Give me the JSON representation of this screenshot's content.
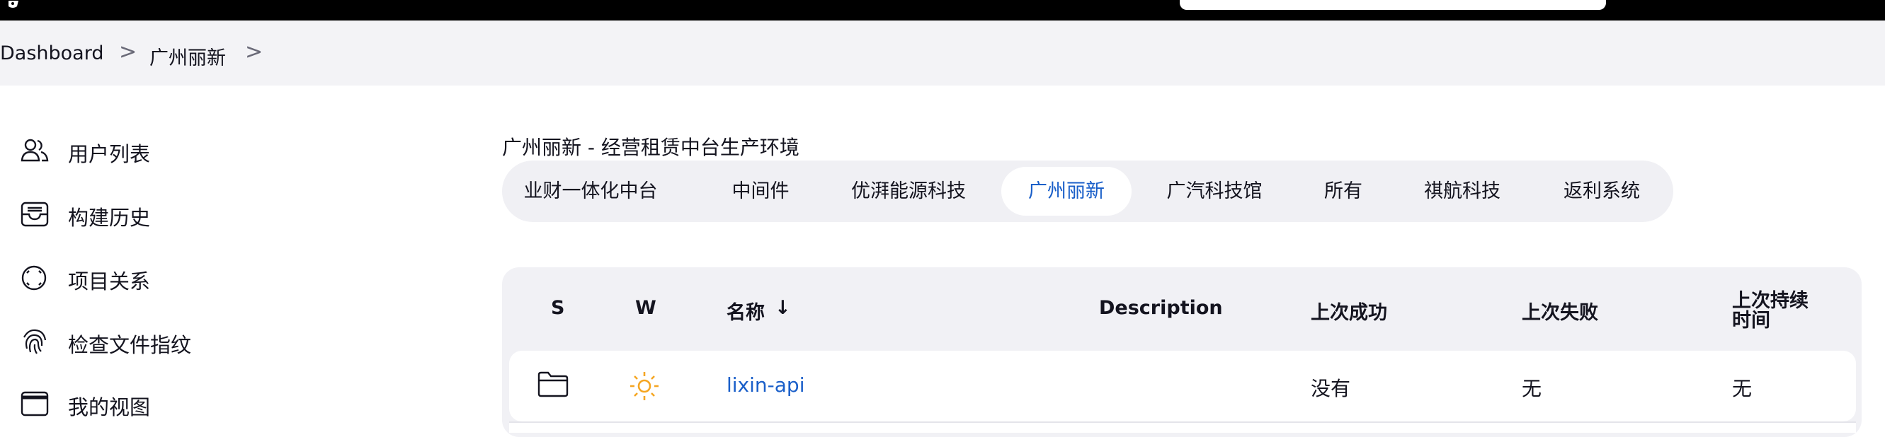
{
  "breadcrumb": {
    "items": [
      "Dashboard",
      "广州丽新"
    ],
    "separator": ">"
  },
  "sidebar": {
    "items": [
      {
        "label": "用户列表",
        "icon": "people-icon"
      },
      {
        "label": "构建历史",
        "icon": "inbox-icon"
      },
      {
        "label": "项目关系",
        "icon": "relationship-icon"
      },
      {
        "label": "检查文件指纹",
        "icon": "fingerprint-icon"
      },
      {
        "label": "我的视图",
        "icon": "window-icon"
      }
    ]
  },
  "view": {
    "description": "广州丽新 - 经营租赁中台生产环境"
  },
  "tabs": [
    {
      "label": "业财一体化中台",
      "active": false
    },
    {
      "label": "中间件",
      "active": false
    },
    {
      "label": "优湃能源科技",
      "active": false
    },
    {
      "label": "广州丽新",
      "active": true
    },
    {
      "label": "广汽科技馆",
      "active": false
    },
    {
      "label": "所有",
      "active": false
    },
    {
      "label": "祺航科技",
      "active": false
    },
    {
      "label": "返利系统",
      "active": false
    }
  ],
  "table": {
    "headers": {
      "s": "S",
      "w": "W",
      "name": "名称",
      "sort_indicator": "↓",
      "description": "Description",
      "last_success": "上次成功",
      "last_failure": "上次失败",
      "last_duration": "上次持续时间"
    },
    "rows": [
      {
        "status_icon": "folder-icon",
        "weather_icon": "sun-icon",
        "name": "lixin-api",
        "description": "",
        "last_success": "没有",
        "last_failure": "无",
        "last_duration": "无"
      }
    ]
  },
  "colors": {
    "accent": "#1a5fc9",
    "weather_sun": "#f5a623"
  }
}
